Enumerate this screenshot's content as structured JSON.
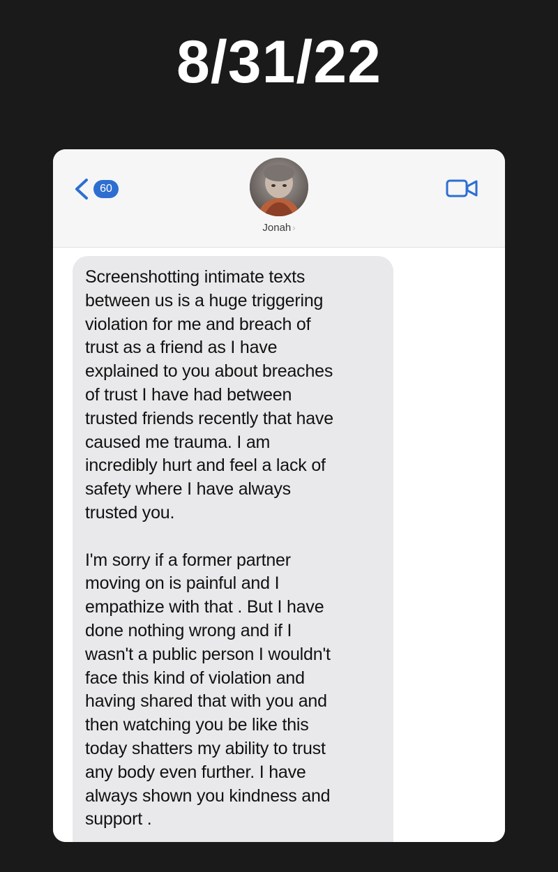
{
  "date_title": "8/31/22",
  "header": {
    "back_badge": "60",
    "contact_name": "Jonah",
    "name_chevron": "›",
    "icons": {
      "back": "chevron-left-icon",
      "video": "video-camera-icon"
    },
    "accent_color": "#2d6fd1"
  },
  "message": {
    "paragraph_1": "Screenshotting intimate texts\nbetween us is a huge triggering\nviolation for me and breach of\ntrust as a friend as I have\nexplained to you about breaches\nof trust I have had between\ntrusted friends recently that have\ncaused me trauma. I am\nincredibly hurt and feel a lack of\nsafety where I have always\ntrusted you.",
    "paragraph_2": "I'm sorry if a former partner\nmoving on is painful and I\nempathize with that . But I have\ndone nothing wrong and if I\nwasn't a public person I wouldn't\nface this kind of violation and\nhaving shared that with you and\nthen watching you be like this\ntoday shatters my ability to trust\nany body even further. I have\nalways shown you kindness and\nsupport ."
  }
}
